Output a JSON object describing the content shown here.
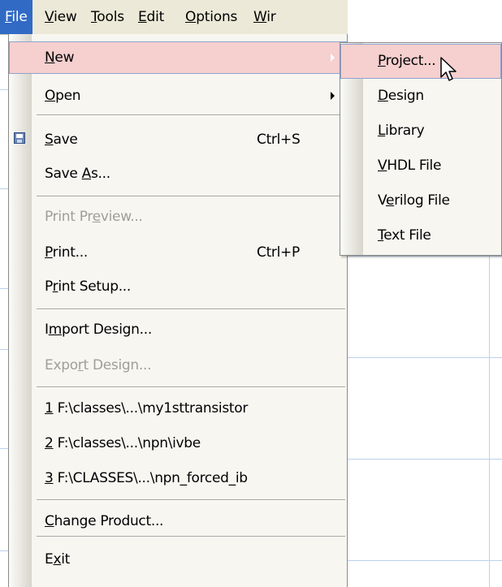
{
  "menubar": {
    "items": [
      {
        "label": "File",
        "mnemonic": 0,
        "active": true
      },
      {
        "label": "View",
        "mnemonic": 0
      },
      {
        "label": "Tools",
        "mnemonic": 0
      },
      {
        "label": "Edit",
        "mnemonic": 0
      },
      {
        "label": "Options",
        "mnemonic": 0
      },
      {
        "label": "Wir",
        "mnemonic": 0
      }
    ]
  },
  "file_menu": {
    "items": [
      {
        "label": "New",
        "mnemonic": 0,
        "submenu": true,
        "highlighted": true
      },
      {
        "label": "Open",
        "mnemonic": 0,
        "submenu": true
      },
      {
        "label": "Save",
        "mnemonic": 0,
        "shortcut": "Ctrl+S",
        "icon": "save-icon"
      },
      {
        "label": "Save As...",
        "mnemonic": 5
      },
      {
        "label": "Print Preview...",
        "mnemonic": 8,
        "disabled": true
      },
      {
        "label": "Print...",
        "mnemonic": 0,
        "shortcut": "Ctrl+P"
      },
      {
        "label": "Print Setup...",
        "mnemonic": 1
      },
      {
        "label": "Import Design...",
        "mnemonic": 1
      },
      {
        "label": "Export Design...",
        "mnemonic": 4,
        "disabled": true
      },
      {
        "label": "1 F:\\classes\\...\\my1sttransistor",
        "mnemonic": 0
      },
      {
        "label": "2 F:\\classes\\...\\npn\\ivbe",
        "mnemonic": 0
      },
      {
        "label": "3 F:\\CLASSES\\...\\npn_forced_ib",
        "mnemonic": 0
      },
      {
        "label": "Change Product...",
        "mnemonic": 0
      },
      {
        "label": "Exit",
        "mnemonic": 1
      }
    ]
  },
  "new_submenu": {
    "items": [
      {
        "label": "Project...",
        "mnemonic": 0,
        "highlighted": true
      },
      {
        "label": "Design",
        "mnemonic": 0
      },
      {
        "label": "Library",
        "mnemonic": 0
      },
      {
        "label": "VHDL File",
        "mnemonic": 0
      },
      {
        "label": "Verilog File",
        "mnemonic": 1
      },
      {
        "label": "Text File",
        "mnemonic": 0
      }
    ]
  },
  "colors": {
    "menubar_bg": "#ece9d8",
    "active_menu_bg": "#316ac5",
    "highlight_bg": "#f6cfcf",
    "disabled_text": "#9f9e99"
  }
}
